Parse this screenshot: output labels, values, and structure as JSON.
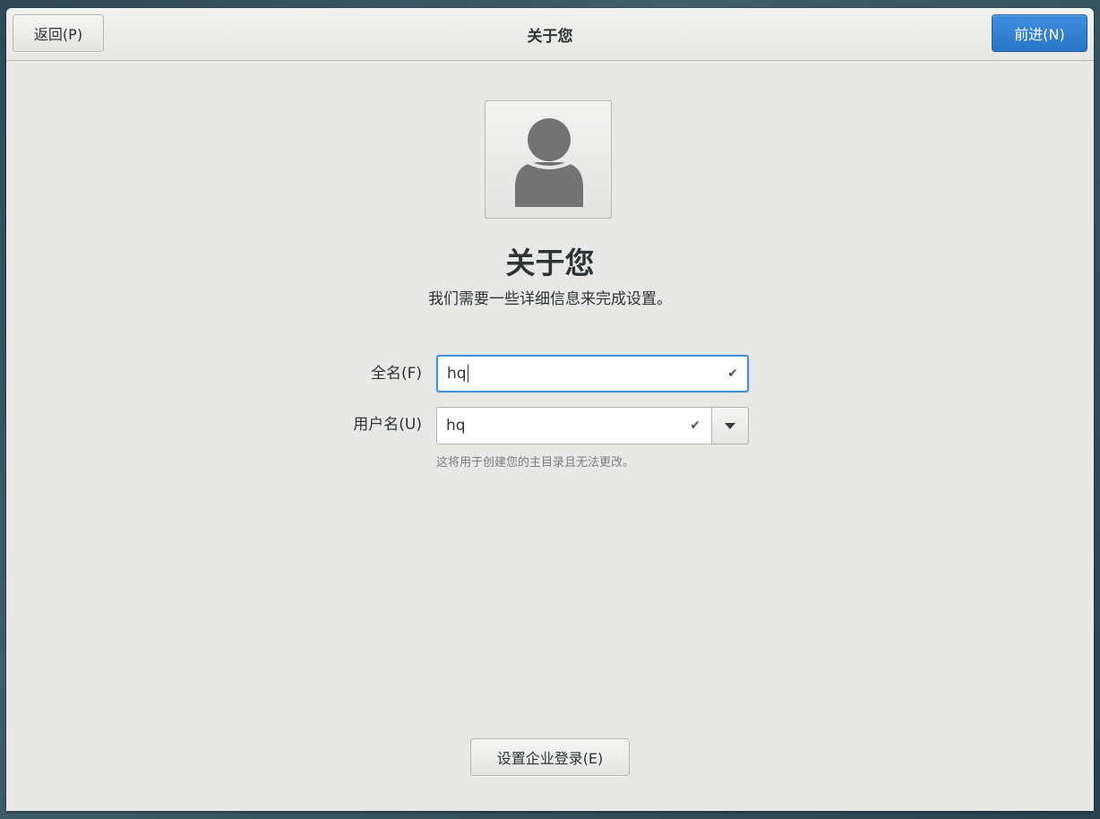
{
  "header": {
    "back_label": "返回(P)",
    "title": "关于您",
    "next_label": "前进(N)"
  },
  "main": {
    "avatar_icon": "user-avatar-icon",
    "title": "关于您",
    "subtitle": "我们需要一些详细信息来完成设置。"
  },
  "form": {
    "fullname": {
      "label": "全名(F)",
      "value": "hq",
      "status_icon": "check-icon"
    },
    "username": {
      "label": "用户名(U)",
      "value": "hq",
      "status_icon": "check-icon",
      "hint": "这将用于创建您的主目录且无法更改。"
    }
  },
  "footer": {
    "enterprise_label": "设置企业登录(E)"
  },
  "colors": {
    "accent": "#3584e4",
    "window_bg": "#e8e8e7",
    "focus_border": "#4a90d9"
  }
}
